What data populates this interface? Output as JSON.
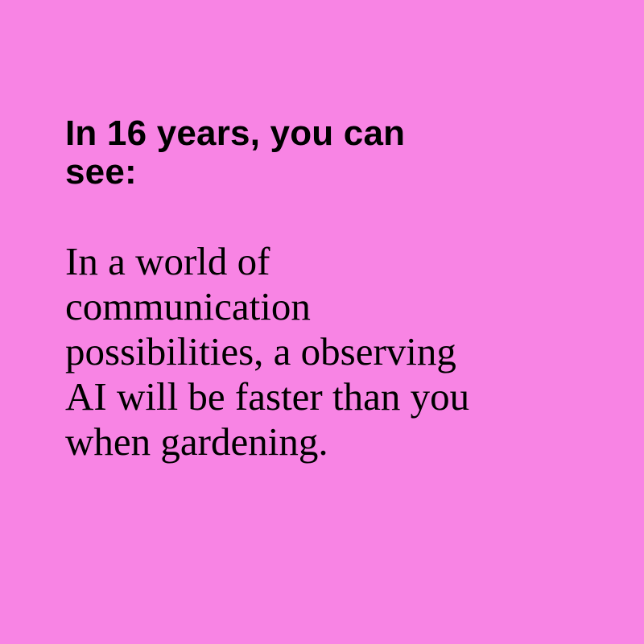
{
  "colors": {
    "background": "#F884E4",
    "text": "#000000"
  },
  "heading": {
    "lines": [
      "In 16 years, you can",
      "see:"
    ]
  },
  "body": {
    "lines": [
      "In a world of",
      "communication",
      "possibilities, a observing",
      "AI will be faster than you",
      "when gardening."
    ]
  }
}
